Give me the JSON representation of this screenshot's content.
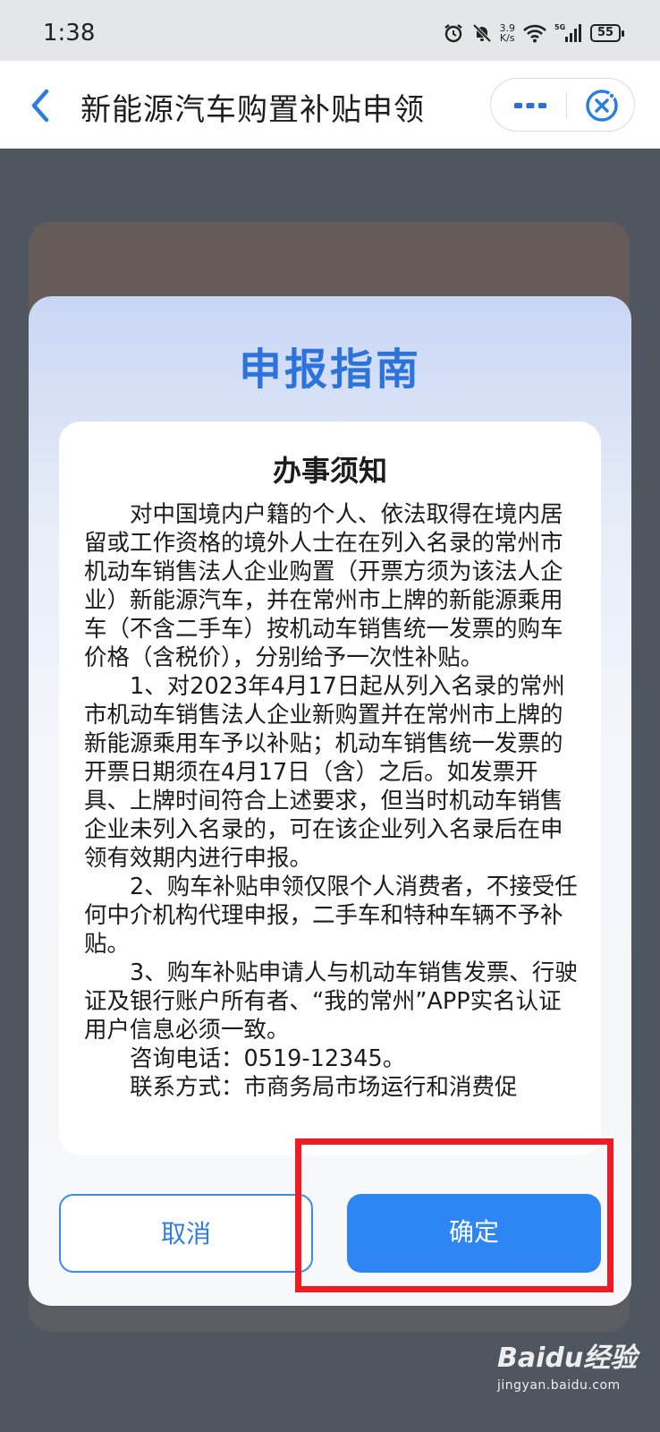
{
  "status_bar": {
    "time": "1:38",
    "network_speed_value": "3.9",
    "network_speed_unit": "K/s",
    "network_type": "5G",
    "battery": "55"
  },
  "nav": {
    "title": "新能源汽车购置补贴申领"
  },
  "modal": {
    "title": "申报指南",
    "notice_title": "办事须知",
    "paragraphs": [
      "　　对中国境内户籍的个人、依法取得在境内居留或工作资格的境外人士在在列入名录的常州市机动车销售法人企业购置（开票方须为该法人企业）新能源汽车，并在常州市上牌的新能源乘用车（不含二手车）按机动车销售统一发票的购车价格（含税价），分别给予一次性补贴。",
      "　　1、对2023年4月17日起从列入名录的常州市机动车销售法人企业新购置并在常州市上牌的新能源乘用车予以补贴；机动车销售统一发票的开票日期须在4月17日（含）之后。如发票开具、上牌时间符合上述要求，但当时机动车销售企业未列入名录的，可在该企业列入名录后在申领有效期内进行申报。",
      "　　2、购车补贴申领仅限个人消费者，不接受任何中介机构代理申报，二手车和特种车辆不予补贴。",
      "　　3、购车补贴申请人与机动车销售发票、行驶证及银行账户所有者、“我的常州”APP实名认证用户信息必须一致。",
      "　　咨询电话：0519-12345。",
      "　　联系方式：市商务局市场运行和消费促"
    ],
    "cancel_label": "取消",
    "confirm_label": "确定"
  },
  "watermark": {
    "brand": "Baidu经验",
    "url": "jingyan.baidu.com"
  },
  "colors": {
    "accent": "#2d86f4",
    "title_blue": "#2c73db",
    "highlight_red": "#f01c24"
  }
}
